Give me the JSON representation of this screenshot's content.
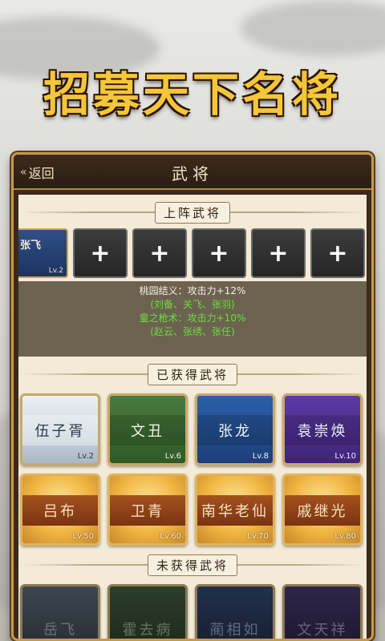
{
  "banner": {
    "title": "招募天下名将"
  },
  "panel": {
    "back_label": "返回",
    "title": "武将"
  },
  "lineup_section": {
    "label": "上阵武将",
    "filled_slot": {
      "name": "张飞",
      "level": "Lv.2"
    },
    "empty_slot_symbol": "+"
  },
  "bonuses": [
    {
      "text": "桃园结义：攻击力+12%",
      "color": "white"
    },
    {
      "text": "(刘备、关飞、张羽)",
      "color": "green"
    },
    {
      "text": "童之枪术：攻击力+10%",
      "color": "green"
    },
    {
      "text": "(赵云、张绣、张任)",
      "color": "green"
    }
  ],
  "owned_section": {
    "label": "已获得武将",
    "generals": [
      {
        "name": "伍子胥",
        "level": "Lv.2",
        "rarity": "white"
      },
      {
        "name": "文丑",
        "level": "Lv.6",
        "rarity": "green"
      },
      {
        "name": "张龙",
        "level": "Lv.8",
        "rarity": "blue"
      },
      {
        "name": "袁崇焕",
        "level": "Lv.10",
        "rarity": "purple"
      },
      {
        "name": "吕布",
        "level": "Lv.50",
        "rarity": "gold"
      },
      {
        "name": "卫青",
        "level": "Lv.60",
        "rarity": "gold"
      },
      {
        "name": "南华老仙",
        "level": "Lv.70",
        "rarity": "gold"
      },
      {
        "name": "戚继光",
        "level": "Lv.80",
        "rarity": "gold"
      }
    ]
  },
  "locked_section": {
    "label": "未获得武将",
    "generals": [
      {
        "name": "岳飞",
        "rarity": "gray"
      },
      {
        "name": "霍去病",
        "rarity": "green"
      },
      {
        "name": "蔺相如",
        "rarity": "blue"
      },
      {
        "name": "文天祥",
        "rarity": "purple"
      }
    ]
  },
  "colors": {
    "banner_gold": "#f4c63a",
    "panel_frame": "#c69a4b",
    "bonus_green": "#6dde3c"
  }
}
